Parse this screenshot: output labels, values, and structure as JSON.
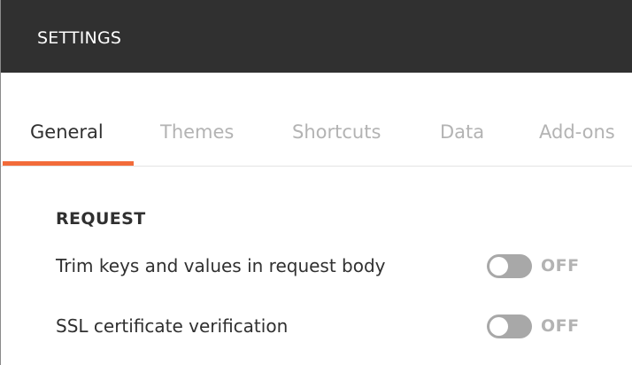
{
  "window": {
    "title": "SETTINGS"
  },
  "tabs": [
    {
      "label": "General",
      "active": true
    },
    {
      "label": "Themes",
      "active": false
    },
    {
      "label": "Shortcuts",
      "active": false
    },
    {
      "label": "Data",
      "active": false
    },
    {
      "label": "Add-ons",
      "active": false
    }
  ],
  "sections": {
    "request": {
      "heading": "REQUEST",
      "settings": [
        {
          "label": "Trim keys and values in request body",
          "state": "OFF",
          "enabled": false
        },
        {
          "label": "SSL certificate verification",
          "state": "OFF",
          "enabled": false
        }
      ]
    }
  },
  "colors": {
    "titlebar": "#303030",
    "accent": "#f26b3a",
    "toggle_off": "#a8a8a8",
    "inactive_text": "#b3b3b3",
    "text": "#303030"
  }
}
